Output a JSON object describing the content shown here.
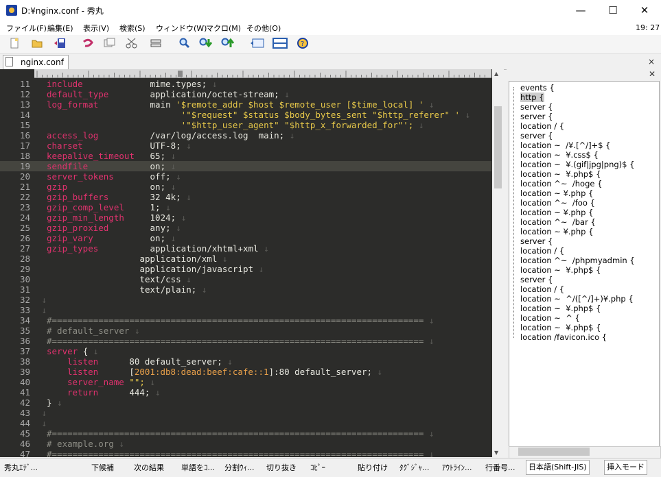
{
  "window": {
    "title": "D:¥nginx.conf - 秀丸",
    "min_glyph": "—",
    "max_glyph": "☐",
    "close_glyph": "✕"
  },
  "menu": {
    "items": [
      "ファイル(F)",
      "編集(E)",
      "表示(V)",
      "検索(S)",
      "ウィンドウ(W)",
      "マクロ(M)",
      "その他(O)"
    ],
    "clock": "19: 27"
  },
  "toolbar": {
    "icons": [
      "new-file-icon",
      "open-folder-icon",
      "save-icon",
      "undo-icon",
      "copy-icon",
      "cut-icon",
      "paste-icon",
      "search-icon",
      "search-down-icon",
      "search-up-icon",
      "prev-window-icon",
      "split-window-icon",
      "help-icon"
    ]
  },
  "tab": {
    "label": "nginx.conf",
    "close_glyph": "×"
  },
  "editor": {
    "current_line": "19",
    "lines": [
      {
        "n": "11",
        "k": "include",
        "v": "mime.types;"
      },
      {
        "n": "12",
        "k": "default_type",
        "v": "application/octet-stream;"
      },
      {
        "n": "13",
        "k": "log_format",
        "v": "main '$remote_addr $host $remote_user [$time_local] '"
      },
      {
        "n": "14",
        "k": "",
        "v": "'\"$request\" $status $body_bytes_sent \"$http_referer\" '"
      },
      {
        "n": "15",
        "k": "",
        "v": "'\"$http_user_agent\" \"$http_x_forwarded_for\"';"
      },
      {
        "n": "16",
        "k": "access_log",
        "v": "/var/log/access.log  main;"
      },
      {
        "n": "17",
        "k": "charset",
        "v": "UTF-8;"
      },
      {
        "n": "18",
        "k": "keepalive_timeout",
        "v": "65;"
      },
      {
        "n": "19",
        "k": "sendfile",
        "v": "on;"
      },
      {
        "n": "20",
        "k": "server_tokens",
        "v": "off;"
      },
      {
        "n": "21",
        "k": "gzip",
        "v": "on;"
      },
      {
        "n": "22",
        "k": "gzip_buffers",
        "v": "32 4k;"
      },
      {
        "n": "23",
        "k": "gzip_comp_level",
        "v": "1;"
      },
      {
        "n": "24",
        "k": "gzip_min_length",
        "v": "1024;"
      },
      {
        "n": "25",
        "k": "gzip_proxied",
        "v": "any;"
      },
      {
        "n": "26",
        "k": "gzip_vary",
        "v": "on;"
      },
      {
        "n": "27",
        "k": "gzip_types",
        "v": "application/xhtml+xml"
      },
      {
        "n": "28",
        "k": "",
        "v": "application/xml"
      },
      {
        "n": "29",
        "k": "",
        "v": "application/javascript"
      },
      {
        "n": "30",
        "k": "",
        "v": "text/css"
      },
      {
        "n": "31",
        "k": "",
        "v": "text/plain;"
      },
      {
        "n": "32",
        "k": "",
        "v": ""
      },
      {
        "n": "33",
        "k": "",
        "v": ""
      },
      {
        "n": "34",
        "c": "#========================================================================"
      },
      {
        "n": "35",
        "c": "# default_server"
      },
      {
        "n": "36",
        "c": "#========================================================================"
      },
      {
        "n": "37",
        "k": "server",
        "v": "{"
      },
      {
        "n": "38",
        "k": "listen",
        "v": "80 default_server;"
      },
      {
        "n": "39",
        "k": "listen",
        "v": "[2001:db8:dead:beef:cafe::1]:80 default_server;"
      },
      {
        "n": "40",
        "k": "server_name",
        "v": "\"\";"
      },
      {
        "n": "41",
        "k": "return",
        "v": "444;"
      },
      {
        "n": "42",
        "k": "",
        "v": "}"
      },
      {
        "n": "43",
        "k": "",
        "v": ""
      },
      {
        "n": "44",
        "k": "",
        "v": ""
      },
      {
        "n": "45",
        "c": "#========================================================================"
      },
      {
        "n": "46",
        "c": "# example.org"
      },
      {
        "n": "47",
        "c": "#========================================================================"
      }
    ]
  },
  "outline": {
    "items": [
      "events {",
      "http {",
      "server {",
      "server {",
      "location / {",
      "server {",
      "location ~  /¥.[^/]+$ {",
      "location ~  ¥.css$ {",
      "location ~  ¥.(gif|jpg|png)$ {",
      "location ~  ¥.php$ {",
      "location ^~  /hoge {",
      "location ~ ¥.php {",
      "location ^~  /foo {",
      "location ~ ¥.php {",
      "location ^~  /bar {",
      "location ~ ¥.php {",
      "server {",
      "location / {",
      "location ^~  /phpmyadmin {",
      "location ~  ¥.php$ {",
      "server {",
      "location / {",
      "location ~  ^/([^/]+)¥.php {",
      "location ~  ¥.php$ {",
      "location ~  ^ {",
      "location ~  ¥.php$ {",
      "location /favicon.ico {"
    ],
    "selected": "http {"
  },
  "status": {
    "items": [
      "秀丸ｴﾃﾞ...",
      "下候補",
      "次の結果",
      "単語をｺ...",
      "分割ｳｨ...",
      "切り抜き",
      "ｺﾋﾟｰ",
      "貼り付け",
      "ﾀｸﾞｼﾞｬ...",
      "ｱｳﾄﾗｲﾝ...",
      "行番号..."
    ],
    "encoding": "日本語(Shift-JIS)",
    "mode": "挿入モード"
  },
  "colors": {
    "editor_bg": "#2c2c2a",
    "keyword": "#e0326e",
    "text": "#e8e8e0",
    "string": "#e8c94a",
    "comment": "#8c8c84",
    "ipv6": "#e8a04a"
  }
}
